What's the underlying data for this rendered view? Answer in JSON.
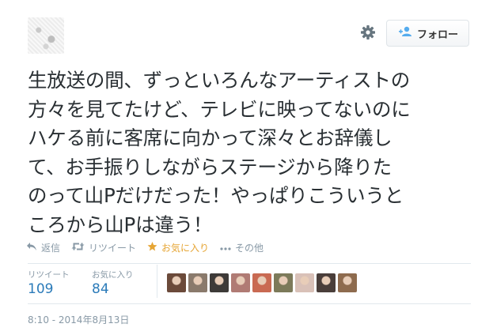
{
  "header": {
    "follow_label": "フォロー"
  },
  "tweet": {
    "lines": [
      "生放送の間、ずっといろんなアーティストの",
      "方々を見てたけど、テレビに映ってないのに",
      "ハケる前に客席に向かって深々とお辞儀し",
      "て、お手振りしながらステージから降りた",
      "のって山Pだけだった！やっぱりこういうと",
      "ころから山Pは違う！"
    ]
  },
  "actions": {
    "reply": "返信",
    "retweet": "リツイート",
    "favorite": "お気に入り",
    "more": "その他"
  },
  "stats": {
    "retweets_label": "リツイート",
    "retweets_value": "109",
    "favorites_label": "お気に入り",
    "favorites_value": "84"
  },
  "favoriters": {
    "count": 9,
    "colors": [
      "#6b4a3a",
      "#8a7a6c",
      "#3d3a38",
      "#b07b74",
      "#c96a52",
      "#7c7a5a",
      "#d9c1b8",
      "#4a3e3a",
      "#8e6b4e"
    ]
  },
  "timestamp": "8:10 - 2014年8月13日",
  "colors": {
    "text": "#292f33",
    "muted": "#8899a6",
    "link": "#2b7bb9",
    "favorite": "#e6a534",
    "divider": "#e1e8ed"
  },
  "icons": [
    "gear-icon",
    "follow-person-icon",
    "reply-icon",
    "retweet-icon",
    "star-icon",
    "more-icon"
  ]
}
